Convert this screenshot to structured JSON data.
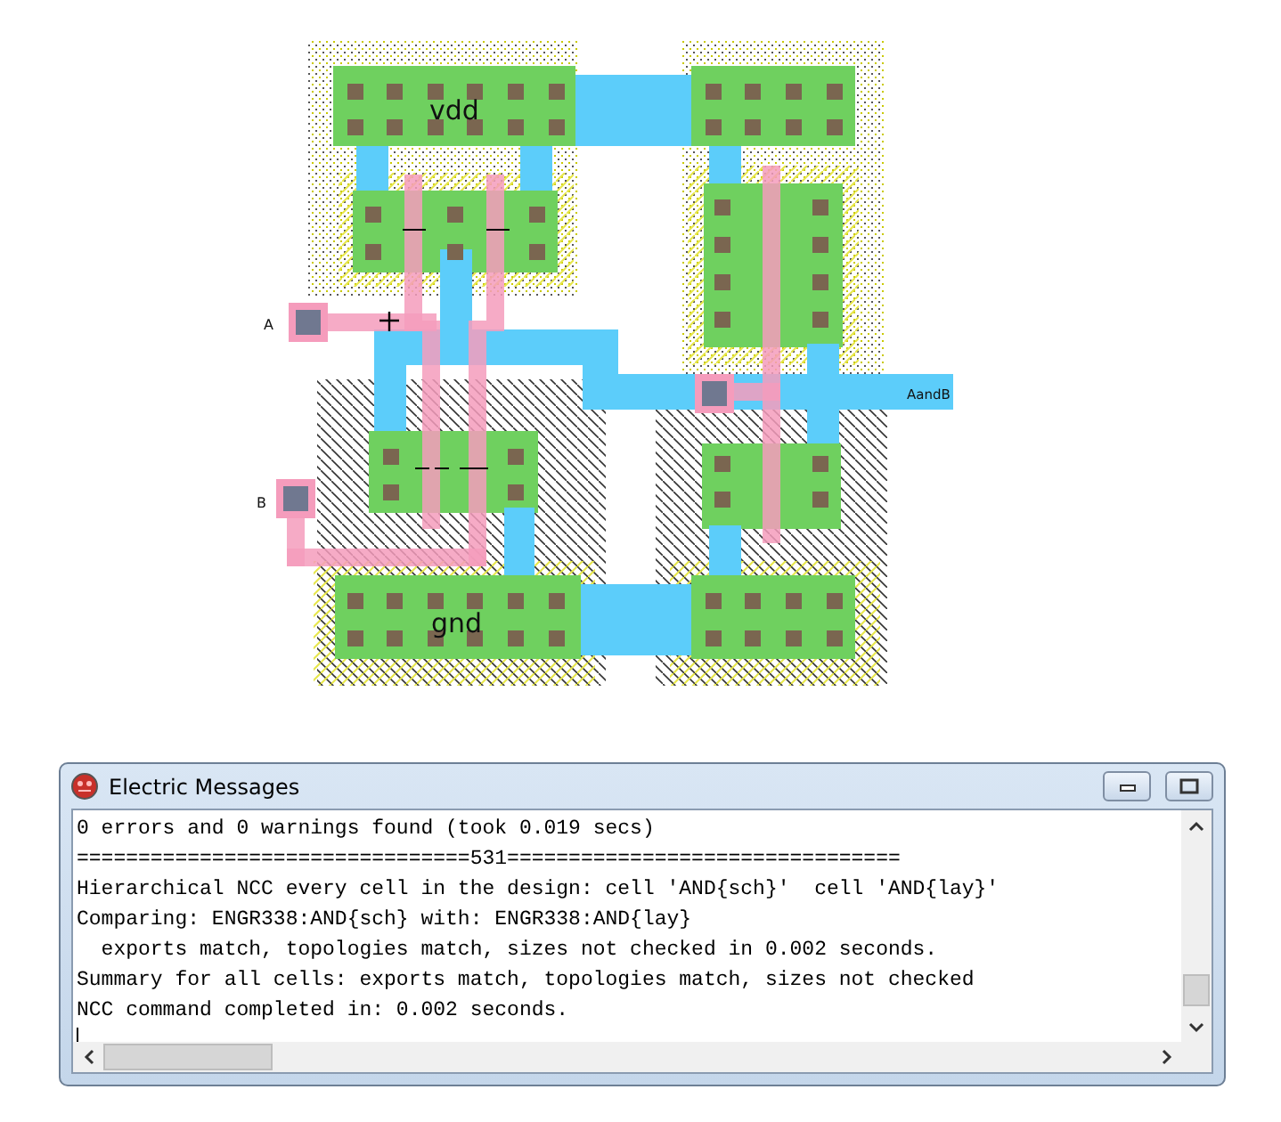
{
  "layout": {
    "power_label": "vdd",
    "ground_label": "gnd",
    "input_a_label": "A",
    "input_b_label": "B",
    "output_label": "AandB"
  },
  "messages_window": {
    "title": "Electric Messages",
    "lines": [
      "0 errors and 0 warnings found (took 0.019 secs)",
      "================================531================================",
      "Hierarchical NCC every cell in the design: cell 'AND{sch}'  cell 'AND{lay}'",
      "Comparing: ENGR338:AND{sch} with: ENGR338:AND{lay}",
      "  exports match, topologies match, sizes not checked in 0.002 seconds.",
      "Summary for all cells: exports match, topologies match, sizes not checked",
      "NCC command completed in: 0.002 seconds."
    ]
  }
}
